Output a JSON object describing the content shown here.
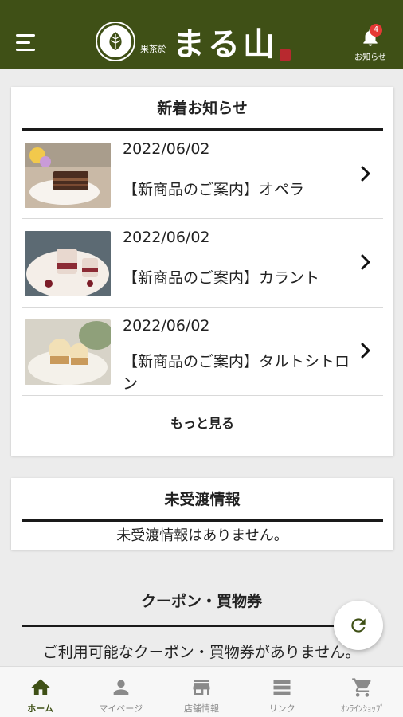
{
  "header": {
    "logo_sub": "果茶於",
    "logo_main": "まる山",
    "notice_label": "お知らせ",
    "notice_count": "4"
  },
  "news": {
    "title": "新着お知らせ",
    "items": [
      {
        "date": "2022/06/02",
        "text": "【新商品のご案内】オペラ"
      },
      {
        "date": "2022/06/02",
        "text": "【新商品のご案内】カラント"
      },
      {
        "date": "2022/06/02",
        "text": "【新商品のご案内】タルトシトロン"
      }
    ],
    "more_label": "もっと見る"
  },
  "unreceived": {
    "title": "未受渡情報",
    "message": "未受渡情報はありません。"
  },
  "coupon": {
    "title": "クーポン・買物券",
    "message": "ご利用可能なクーポン・買物券がありません。"
  },
  "tabs": [
    {
      "label": "ホーム",
      "icon": "home-icon",
      "active": true
    },
    {
      "label": "マイページ",
      "icon": "person-icon",
      "active": false
    },
    {
      "label": "店舗情報",
      "icon": "store-icon",
      "active": false
    },
    {
      "label": "リンク",
      "icon": "list-icon",
      "active": false
    },
    {
      "label": "ｵﾝﾗｲﾝｼｮｯﾌﾟ",
      "icon": "cart-icon",
      "active": false
    }
  ],
  "colors": {
    "brand": "#3f5016",
    "badge": "#e53935"
  }
}
